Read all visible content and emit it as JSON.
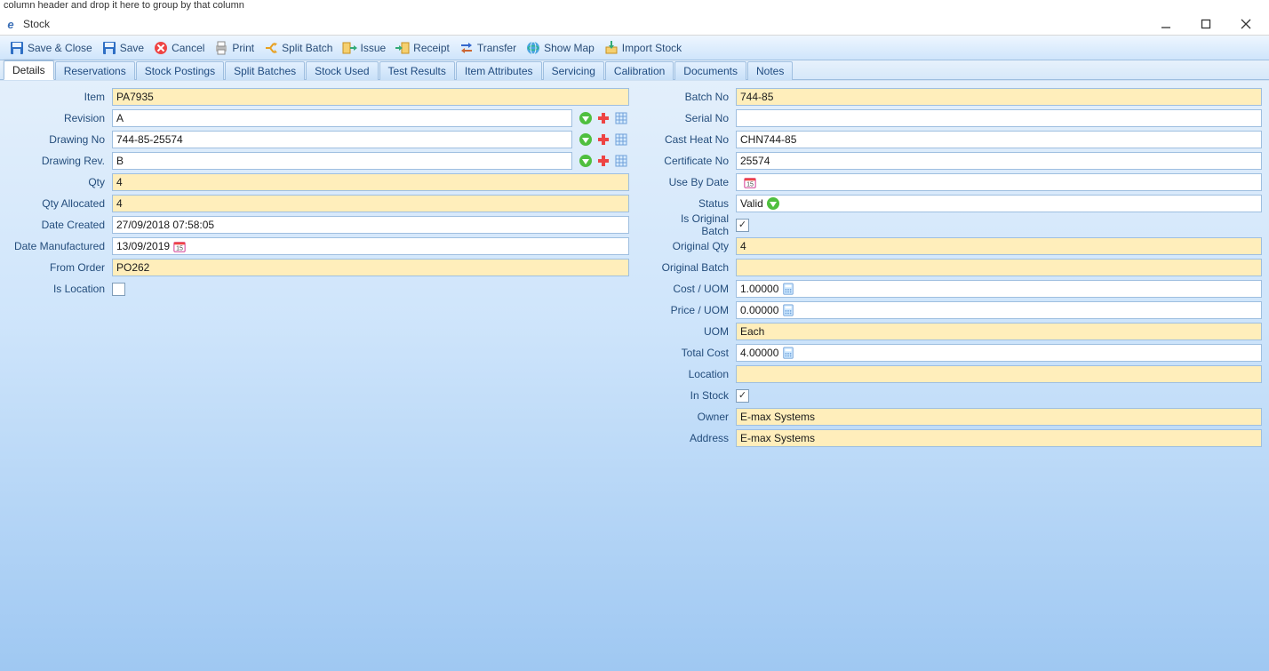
{
  "topHint": "column header and drop it here to group by that column",
  "window": {
    "title": "Stock"
  },
  "toolbar": [
    {
      "name": "save-close-button",
      "icon": "save",
      "label": "Save & Close"
    },
    {
      "name": "save-button",
      "icon": "save",
      "label": "Save"
    },
    {
      "name": "cancel-button",
      "icon": "cancel",
      "label": "Cancel"
    },
    {
      "name": "print-button",
      "icon": "print",
      "label": "Print"
    },
    {
      "name": "split-batch-button",
      "icon": "split",
      "label": "Split Batch"
    },
    {
      "name": "issue-button",
      "icon": "issue",
      "label": "Issue"
    },
    {
      "name": "receipt-button",
      "icon": "receipt",
      "label": "Receipt"
    },
    {
      "name": "transfer-button",
      "icon": "transfer",
      "label": "Transfer"
    },
    {
      "name": "show-map-button",
      "icon": "map",
      "label": "Show Map"
    },
    {
      "name": "import-stock-button",
      "icon": "import",
      "label": "Import Stock"
    }
  ],
  "tabs": [
    {
      "name": "tab-details",
      "label": "Details",
      "active": true
    },
    {
      "name": "tab-reservations",
      "label": "Reservations"
    },
    {
      "name": "tab-stock-postings",
      "label": "Stock Postings"
    },
    {
      "name": "tab-split-batches",
      "label": "Split Batches"
    },
    {
      "name": "tab-stock-used",
      "label": "Stock Used"
    },
    {
      "name": "tab-test-results",
      "label": "Test Results"
    },
    {
      "name": "tab-item-attributes",
      "label": "Item Attributes"
    },
    {
      "name": "tab-servicing",
      "label": "Servicing"
    },
    {
      "name": "tab-calibration",
      "label": "Calibration"
    },
    {
      "name": "tab-documents",
      "label": "Documents"
    },
    {
      "name": "tab-notes",
      "label": "Notes"
    }
  ],
  "left": {
    "item": {
      "label": "Item",
      "value": "PA7935",
      "ro": true
    },
    "revision": {
      "label": "Revision",
      "value": "A",
      "ro": false,
      "trail": "lookup"
    },
    "drawingNo": {
      "label": "Drawing No",
      "value": "744-85-25574",
      "ro": false,
      "trail": "lookup"
    },
    "drawingRev": {
      "label": "Drawing Rev.",
      "value": "B",
      "ro": false,
      "trail": "lookup"
    },
    "qty": {
      "label": "Qty",
      "value": "4",
      "ro": true
    },
    "qtyAllocated": {
      "label": "Qty Allocated",
      "value": "4",
      "ro": true
    },
    "dateCreated": {
      "label": "Date Created",
      "value": "27/09/2018 07:58:05",
      "ro": false
    },
    "dateManufactured": {
      "label": "Date Manufactured",
      "value": "13/09/2019",
      "ro": false,
      "trail": "date"
    },
    "fromOrder": {
      "label": "From Order",
      "value": "PO262",
      "ro": true
    },
    "isLocation": {
      "label": "Is Location",
      "checked": false
    }
  },
  "right": {
    "batchNo": {
      "label": "Batch No",
      "value": "744-85",
      "ro": true
    },
    "serialNo": {
      "label": "Serial No",
      "value": "",
      "ro": false
    },
    "castHeatNo": {
      "label": "Cast Heat No",
      "value": "CHN744-85",
      "ro": false
    },
    "certificateNo": {
      "label": "Certificate No",
      "value": "25574",
      "ro": false
    },
    "useByDate": {
      "label": "Use By Date",
      "value": "",
      "ro": false,
      "trail": "date"
    },
    "status": {
      "label": "Status",
      "value": "Valid",
      "ro": false,
      "trail": "down"
    },
    "isOriginalBatch": {
      "label": "Is Original Batch",
      "checked": true
    },
    "originalQty": {
      "label": "Original Qty",
      "value": "4",
      "ro": true
    },
    "originalBatch": {
      "label": "Original Batch",
      "value": "",
      "ro": true
    },
    "costUom": {
      "label": "Cost / UOM",
      "value": "1.00000",
      "ro": false,
      "trail": "calc"
    },
    "priceUom": {
      "label": "Price / UOM",
      "value": "0.00000",
      "ro": false,
      "trail": "calc"
    },
    "uom": {
      "label": "UOM",
      "value": "Each",
      "ro": true
    },
    "totalCost": {
      "label": "Total Cost",
      "value": "4.00000",
      "ro": false,
      "trail": "calc"
    },
    "location": {
      "label": "Location",
      "value": "",
      "ro": true
    },
    "inStock": {
      "label": "In Stock",
      "checked": true
    },
    "owner": {
      "label": "Owner",
      "value": "E-max Systems",
      "ro": true
    },
    "address": {
      "label": "Address",
      "value": "E-max Systems",
      "ro": true
    }
  }
}
